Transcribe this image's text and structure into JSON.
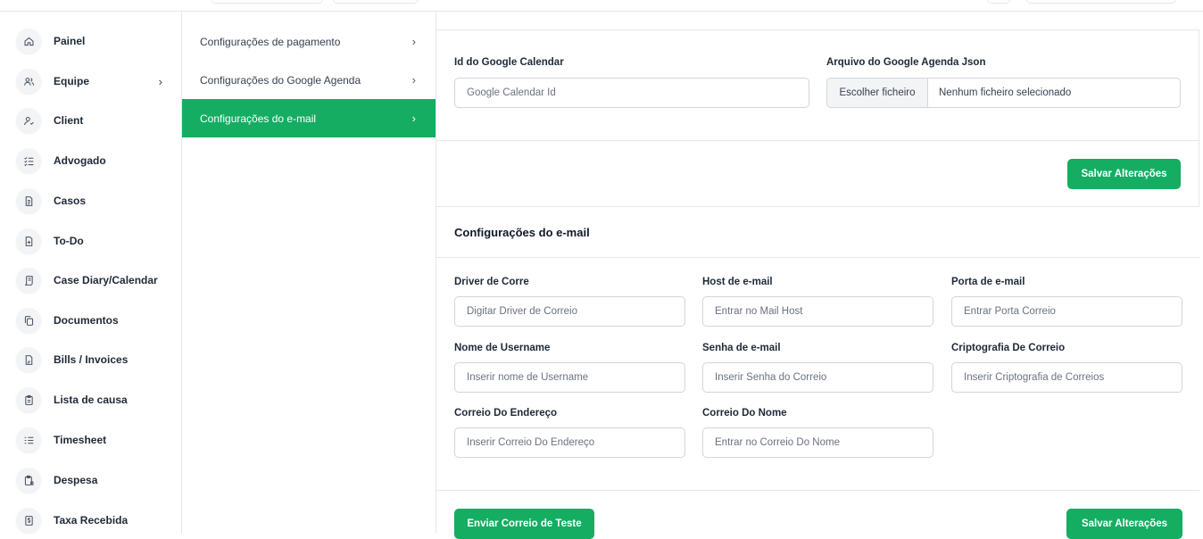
{
  "sidebar": {
    "items": [
      {
        "label": "Painel",
        "icon": "home-icon"
      },
      {
        "label": "Equipe",
        "icon": "users-icon",
        "chevron": "›"
      },
      {
        "label": "Client",
        "icon": "user-check-icon"
      },
      {
        "label": "Advogado",
        "icon": "list-check-icon"
      },
      {
        "label": "Casos",
        "icon": "document-icon"
      },
      {
        "label": "To-Do",
        "icon": "file-plus-icon"
      },
      {
        "label": "Case Diary/Calendar",
        "icon": "diary-icon"
      },
      {
        "label": "Documentos",
        "icon": "copy-icon"
      },
      {
        "label": "Bills / Invoices",
        "icon": "invoice-icon"
      },
      {
        "label": "Lista de causa",
        "icon": "clipboard-icon"
      },
      {
        "label": "Timesheet",
        "icon": "checklist-icon"
      },
      {
        "label": "Despesa",
        "icon": "clipboard-user-icon"
      },
      {
        "label": "Taxa Recebida",
        "icon": "dollar-file-icon"
      }
    ]
  },
  "settings_menu": {
    "items": [
      {
        "label": "Configurações de pagamento",
        "active": false
      },
      {
        "label": "Configurações do Google Agenda",
        "active": false
      },
      {
        "label": "Configurações do e-mail",
        "active": true
      }
    ],
    "chevron": "›"
  },
  "google": {
    "calendar_id_label": "Id do Google Calendar",
    "calendar_id_placeholder": "Google Calendar Id",
    "json_label": "Arquivo do Google Agenda Json",
    "file_button": "Escolher ficheiro",
    "file_status": "Nenhum ficheiro selecionado",
    "save_button": "Salvar Alterações"
  },
  "email": {
    "section_title": "Configurações do e-mail",
    "driver_label": "Driver de Corre",
    "driver_placeholder": "Digitar Driver de Correio",
    "host_label": "Host de e-mail",
    "host_placeholder": "Entrar no Mail Host",
    "port_label": "Porta de e-mail",
    "port_placeholder": "Entrar Porta Correio",
    "username_label": "Nome de Username",
    "username_placeholder": "Inserir nome de Username",
    "password_label": "Senha de e-mail",
    "password_placeholder": "Inserir Senha do Correio",
    "encryption_label": "Criptografia De Correio",
    "encryption_placeholder": "Inserir Criptografia de Correios",
    "from_address_label": "Correio Do Endereço",
    "from_address_placeholder": "Inserir Correio Do Endereço",
    "from_name_label": "Correio Do Nome",
    "from_name_placeholder": "Entrar no Correio Do Nome",
    "test_button": "Enviar Correio de Teste",
    "save_button": "Salvar Alterações"
  },
  "colors": {
    "accent": "#15ad62",
    "border": "#e5e7eb"
  }
}
